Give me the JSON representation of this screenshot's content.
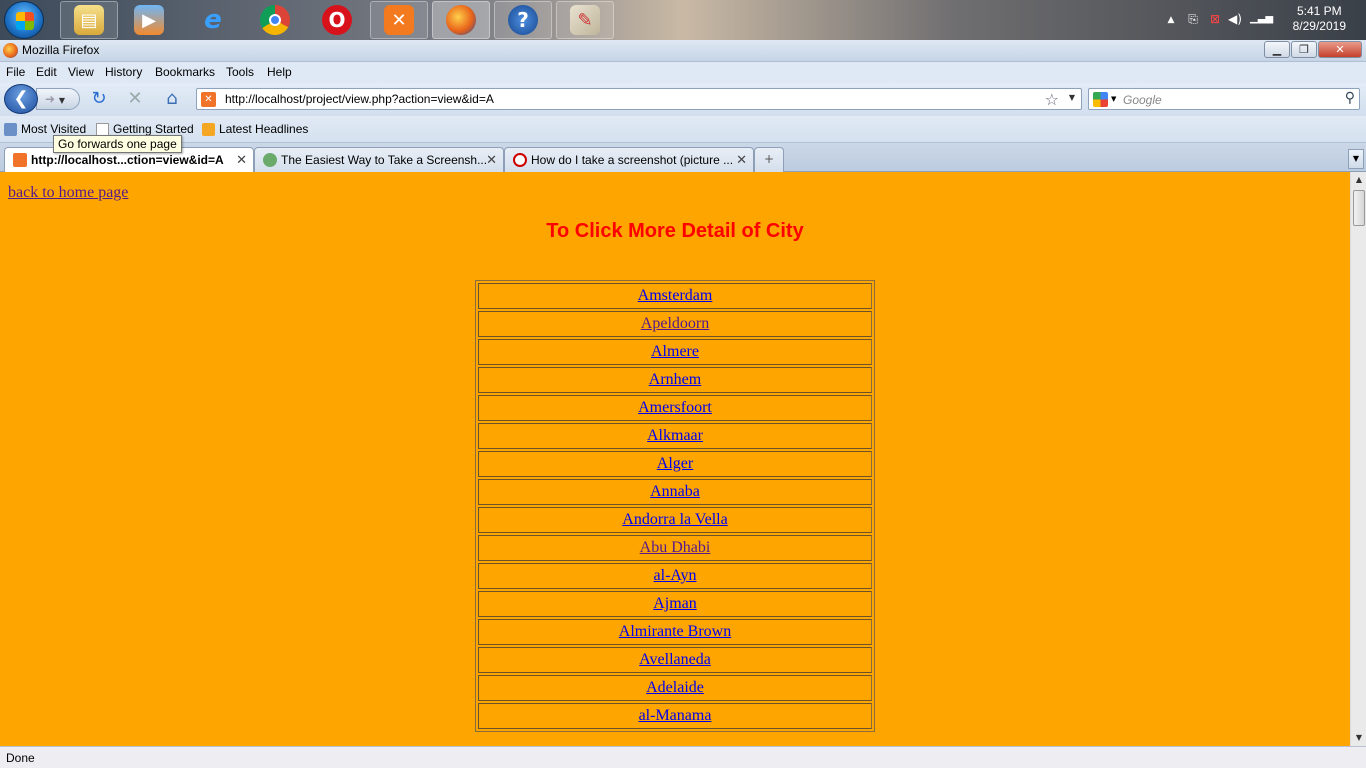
{
  "taskbar": {
    "time": "5:41 PM",
    "date": "8/29/2019",
    "apps": [
      "file-explorer",
      "media-player",
      "internet-explorer",
      "chrome",
      "opera",
      "xampp",
      "firefox",
      "help",
      "paint"
    ]
  },
  "window": {
    "title": "Mozilla Firefox"
  },
  "menu": [
    "File",
    "Edit",
    "View",
    "History",
    "Bookmarks",
    "Tools",
    "Help"
  ],
  "nav": {
    "url": "http://localhost/project/view.php?action=view&id=A",
    "search_placeholder": "Google"
  },
  "bookmarks": [
    "Most Visited",
    "Getting Started",
    "Latest Headlines"
  ],
  "tooltip": "Go forwards one page",
  "tabs": [
    {
      "label": "http://localhost...ction=view&id=A",
      "active": true
    },
    {
      "label": "The Easiest Way to Take a Screensh...",
      "active": false
    },
    {
      "label": "How do I take a screenshot (picture ...",
      "active": false
    }
  ],
  "page": {
    "back_link": "back to home page",
    "heading": "To Click More Detail of City",
    "cities": [
      "Amsterdam",
      "Apeldoorn",
      "Almere",
      "Arnhem",
      "Amersfoort",
      "Alkmaar",
      "Alger",
      "Annaba",
      "Andorra la Vella",
      "Abu Dhabi",
      "al-Ayn",
      "Ajman",
      "Almirante Brown",
      "Avellaneda",
      "Adelaide",
      "al-Manama"
    ],
    "visited": [
      "Apeldoorn",
      "Abu Dhabi"
    ]
  },
  "status": "Done",
  "colors": {
    "page_bg": "#ffa500",
    "heading": "#ff0000",
    "link": "#0000ee",
    "visited_link": "#551a8b"
  }
}
